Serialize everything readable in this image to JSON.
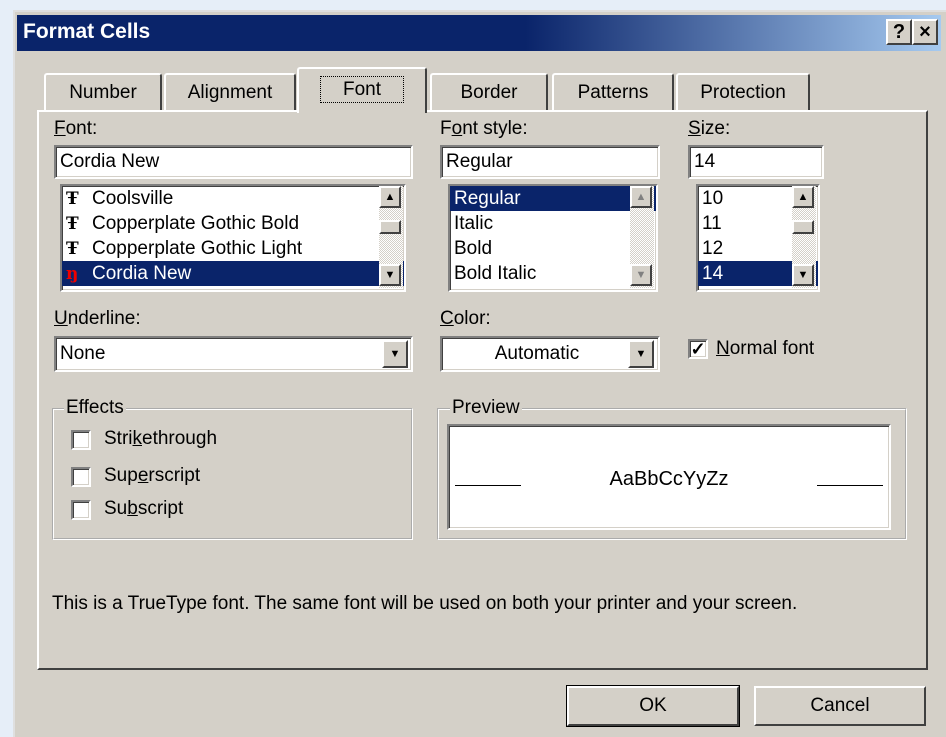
{
  "window": {
    "title": "Format Cells",
    "help_glyph": "?",
    "close_glyph": "×"
  },
  "tabs": [
    {
      "label": "Number"
    },
    {
      "label": "Alignment"
    },
    {
      "label": "Font"
    },
    {
      "label": "Border"
    },
    {
      "label": "Patterns"
    },
    {
      "label": "Protection"
    }
  ],
  "font": {
    "label_first": "F",
    "label_rest": "ont:",
    "value": "Cordia New",
    "items": [
      {
        "icon": "Ŧ",
        "label": "Coolsville"
      },
      {
        "icon": "Ŧ",
        "label": "Copperplate Gothic Bold"
      },
      {
        "icon": "Ŧ",
        "label": "Copperplate Gothic Light"
      },
      {
        "icon": "ŋ",
        "label": "Cordia New"
      }
    ]
  },
  "font_style": {
    "label_pre": "F",
    "label_u": "o",
    "label_post": "nt style:",
    "value": "Regular",
    "items": [
      "Regular",
      "Italic",
      "Bold",
      "Bold Italic"
    ]
  },
  "size": {
    "label_u": "S",
    "label_post": "ize:",
    "value": "14",
    "items": [
      "10",
      "11",
      "12",
      "14"
    ]
  },
  "underline": {
    "label_u": "U",
    "label_post": "nderline:",
    "value": "None"
  },
  "color": {
    "label_u": "C",
    "label_post": "olor:",
    "value": "Automatic"
  },
  "normal_font": {
    "label_u": "N",
    "label_post": "ormal font",
    "checked": "✓"
  },
  "effects": {
    "label": "Effects",
    "strikethrough": {
      "pre": "Stri",
      "u": "k",
      "post": "ethrough"
    },
    "superscript": {
      "pre": "Sup",
      "u": "e",
      "post": "rscript"
    },
    "subscript": {
      "pre": "Su",
      "u": "b",
      "post": "script"
    }
  },
  "preview": {
    "label": "Preview",
    "sample": "AaBbCcYyZz"
  },
  "info_text": "This is a TrueType font.  The same font will be used on both your printer and your screen.",
  "buttons": {
    "ok": "OK",
    "cancel": "Cancel"
  },
  "arrows": {
    "up": "▲",
    "down": "▼"
  },
  "colors": {
    "titlebar": "#0a246a",
    "selection": "#0a246a",
    "face": "#d4d0c8"
  }
}
